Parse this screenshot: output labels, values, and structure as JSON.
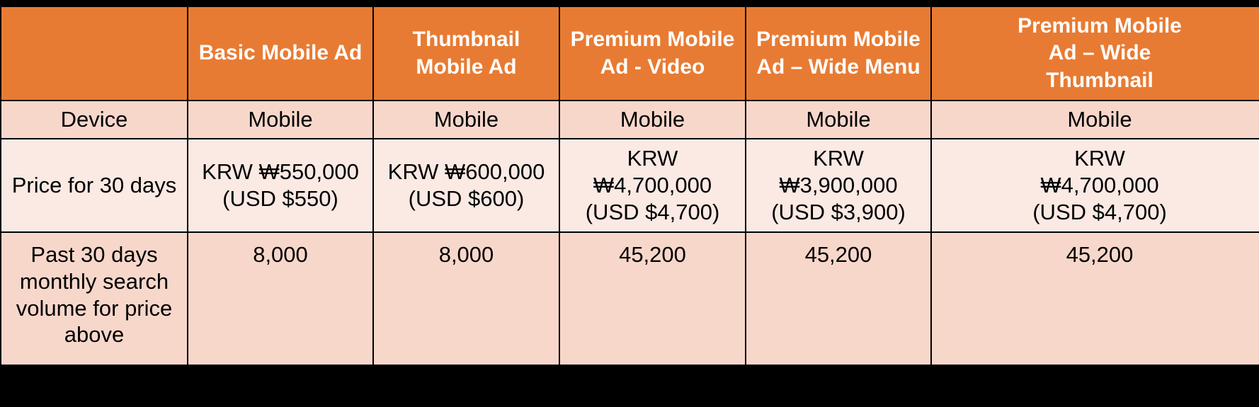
{
  "table": {
    "columns": [
      {
        "id": "row-label",
        "header": ""
      },
      {
        "id": "basic-mobile-ad",
        "header": "Basic Mobile Ad"
      },
      {
        "id": "thumbnail-mobile-ad",
        "header": "Thumbnail Mobile Ad"
      },
      {
        "id": "premium-mobile-ad-video",
        "header": "Premium Mobile Ad - Video"
      },
      {
        "id": "premium-mobile-ad-wide-menu",
        "header": "Premium Mobile Ad – Wide Menu"
      },
      {
        "id": "premium-mobile-ad-wide-thumbnail",
        "header": "Premium Mobile Ad – Wide Thumbnail"
      }
    ],
    "headers": {
      "corner": "",
      "col1_line1": "Basic Mobile Ad",
      "col2_line1": "Thumbnail",
      "col2_line2": "Mobile Ad",
      "col3_line1": "Premium Mobile",
      "col3_line2": "Ad - Video",
      "col4_line1": "Premium Mobile",
      "col4_line2": "Ad – Wide Menu",
      "col5_line1": "Premium Mobile",
      "col5_line2": "Ad – Wide",
      "col5_line3": "Thumbnail"
    },
    "rows": [
      {
        "id": "device",
        "label": "Device",
        "values": [
          "Mobile",
          "Mobile",
          "Mobile",
          "Mobile",
          "Mobile"
        ]
      },
      {
        "id": "price-30-days",
        "label": "Price for 30 days",
        "cells": [
          {
            "line1": "KRW ₩550,000",
            "line2": "(USD $550)",
            "line3": ""
          },
          {
            "line1": "KRW ₩600,000",
            "line2": "(USD $600)",
            "line3": ""
          },
          {
            "line1": "KRW",
            "line2": "₩4,700,000",
            "line3": "(USD $4,700)"
          },
          {
            "line1": "KRW",
            "line2": "₩3,900,000",
            "line3": "(USD $3,900)"
          },
          {
            "line1": "KRW",
            "line2": "₩4,700,000",
            "line3": "(USD $4,700)"
          }
        ]
      },
      {
        "id": "past-30-days-search-volume",
        "label_line1": "Past 30 days",
        "label_line2": "monthly search",
        "label_line3": "volume for price",
        "label_line4": "above",
        "values": [
          "8,000",
          "8,000",
          "45,200",
          "45,200",
          "45,200"
        ]
      }
    ]
  },
  "colors": {
    "header_background": "#E87B33",
    "header_text": "#FFFFFF",
    "row_shaded": "#F8D7CB",
    "row_light": "#FBE9E4",
    "body_text": "#000000",
    "slide_background": "#000000"
  }
}
